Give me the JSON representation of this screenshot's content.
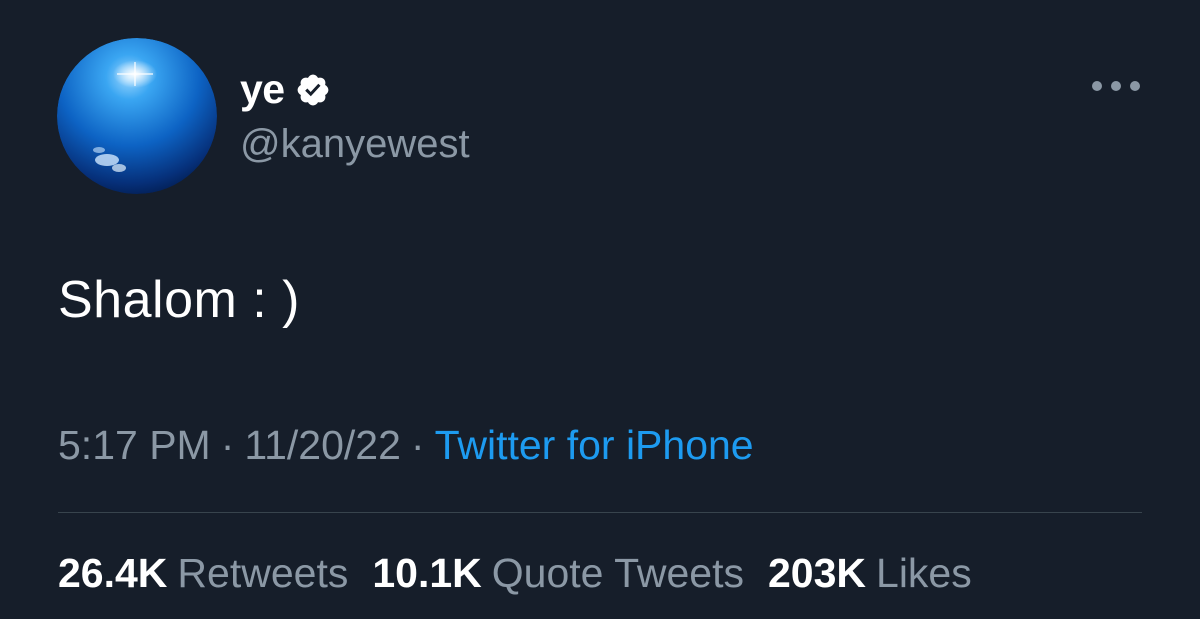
{
  "author": {
    "display_name": "ye",
    "handle": "@kanyewest",
    "verified": true,
    "avatar_icon": "blue-globe-avatar"
  },
  "tweet": {
    "text": "Shalom : )",
    "time": "5:17 PM",
    "date": "11/20/22",
    "separator": "·",
    "source": "Twitter for iPhone"
  },
  "stats": {
    "retweets_count": "26.4K",
    "retweets_label": "Retweets",
    "quotes_count": "10.1K",
    "quotes_label": "Quote Tweets",
    "likes_count": "203K",
    "likes_label": "Likes"
  },
  "colors": {
    "background": "#161e2a",
    "text_primary": "#ffffff",
    "text_secondary": "#8b98a5",
    "link": "#1d9bf0",
    "divider": "#38444d"
  }
}
